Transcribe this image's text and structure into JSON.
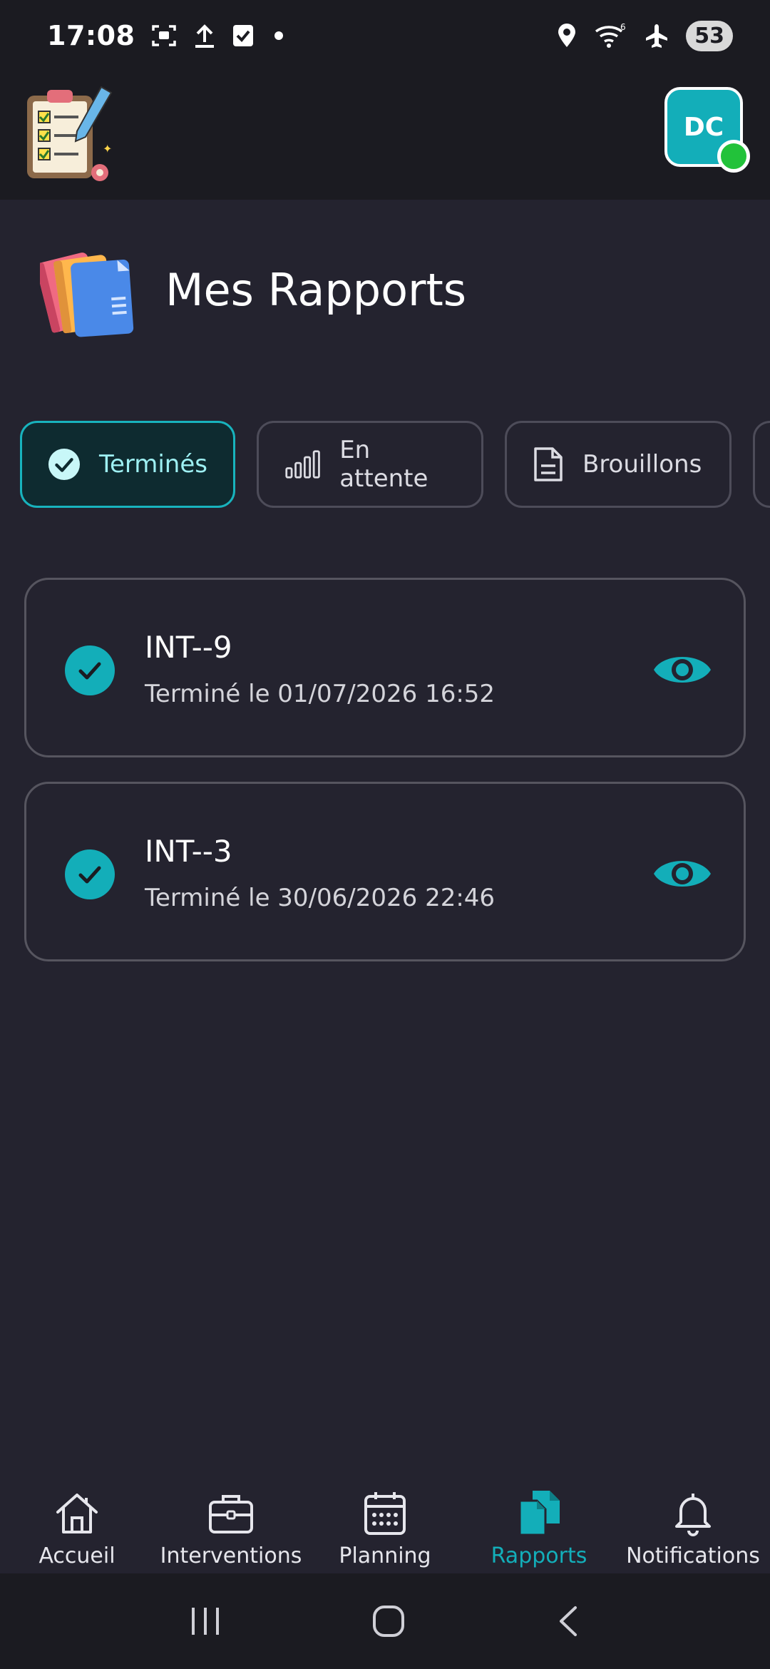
{
  "status_bar": {
    "time": "17:08",
    "battery": "53",
    "icons_left": [
      "screenshot-icon",
      "upload-icon",
      "checkbox-icon",
      "dot-icon"
    ],
    "icons_right": [
      "location-icon",
      "wifi-icon",
      "airplane-icon",
      "battery-icon"
    ]
  },
  "header": {
    "logo": "clipboard-checklist-logo",
    "avatar_initials": "DC",
    "online_color": "#22c23a"
  },
  "page": {
    "title": "Mes Rapports",
    "title_icon": "folders-icon"
  },
  "filters": [
    {
      "label": "Terminés",
      "icon": "check-circle-icon",
      "active": true
    },
    {
      "label": "En attente",
      "icon": "signal-bars-icon",
      "active": false
    },
    {
      "label": "Brouillons",
      "icon": "document-icon",
      "active": false
    }
  ],
  "reports": [
    {
      "id": "INT--9",
      "status_text": "Terminé le 01/07/2026 16:52"
    },
    {
      "id": "INT--3",
      "status_text": "Terminé le 30/06/2026 22:46"
    }
  ],
  "bottom_nav": [
    {
      "label": "Accueil",
      "icon": "home-icon",
      "active": false
    },
    {
      "label": "Interventions",
      "icon": "briefcase-icon",
      "active": false
    },
    {
      "label": "Planning",
      "icon": "calendar-icon",
      "active": false
    },
    {
      "label": "Rapports",
      "icon": "documents-icon",
      "active": true
    },
    {
      "label": "Notifications",
      "icon": "bell-icon",
      "active": false
    }
  ],
  "colors": {
    "accent": "#13aeb9",
    "background": "#24232f",
    "bar_background": "#1b1b21"
  }
}
